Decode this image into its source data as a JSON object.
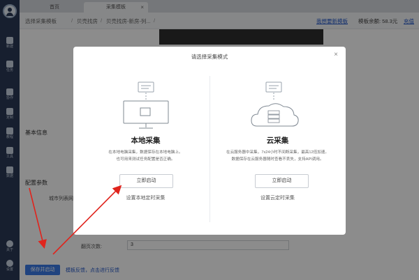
{
  "sidebar": {
    "items": [
      {
        "label": "新建"
      },
      {
        "label": "任务"
      },
      {
        "label": "协作"
      },
      {
        "label": "定制"
      },
      {
        "label": "教程"
      },
      {
        "label": "工具"
      },
      {
        "label": "数据"
      },
      {
        "label": "关于"
      },
      {
        "label": "设置"
      }
    ]
  },
  "tabs": [
    {
      "label": "首页"
    },
    {
      "label": "采集模板"
    }
  ],
  "breadcrumb": {
    "items": [
      "选择采集模板",
      "贝壳找房",
      "贝壳找房-新房-列..."
    ],
    "sep": "/"
  },
  "header": {
    "custom_link": "我想要新模板",
    "balance": "模板余额: 58.3元",
    "recharge": "充值"
  },
  "page": {
    "section_basic": "基本信息",
    "section_config": "配置参数",
    "city_label": "城市列表网",
    "page_count_label": "翻页次数:",
    "page_count_value": "3",
    "save_button": "保存并启动",
    "feedback": "模板反馈，点击进行反馈"
  },
  "modal": {
    "title": "请选择采集模式",
    "local": {
      "title": "本地采集",
      "desc_line1": "在本地电脑采集，数据保存在本地电脑上。",
      "desc_line2": "也可用来测试任务配置是否正确。",
      "button": "立即启动",
      "link": "设置本地定时采集"
    },
    "cloud": {
      "title": "云采集",
      "desc_line1": "在云服务器中采集，7x24小时不间断采集，最高12倍加速。",
      "desc_line2": "数据保存在云服务器随时查看不丢失，支持API调用。",
      "button": "立即启动",
      "link": "设置云定时采集"
    }
  },
  "colors": {
    "sidebar_bg": "#2b3a56",
    "primary": "#3b7be8",
    "link": "#2256c7",
    "arrow": "#e0241d"
  }
}
